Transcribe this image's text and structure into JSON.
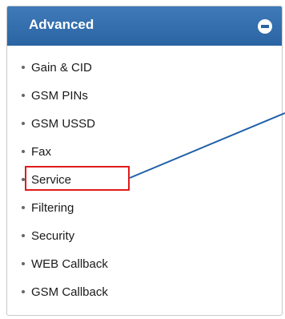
{
  "panel": {
    "title": "Advanced",
    "collapse_icon": "minus-circle-icon",
    "items": [
      {
        "label": "Gain & CID"
      },
      {
        "label": "GSM PINs"
      },
      {
        "label": "GSM USSD"
      },
      {
        "label": "Fax"
      },
      {
        "label": "Service"
      },
      {
        "label": "Filtering"
      },
      {
        "label": "Security"
      },
      {
        "label": "WEB Callback"
      },
      {
        "label": "GSM Callback"
      }
    ]
  },
  "annotation": {
    "highlighted_item": "Service",
    "highlight_color": "#e11b1b",
    "callout_line_color": "#1f5fa8"
  },
  "colors": {
    "header_background": "#2f6aab",
    "header_text": "#ffffff"
  }
}
